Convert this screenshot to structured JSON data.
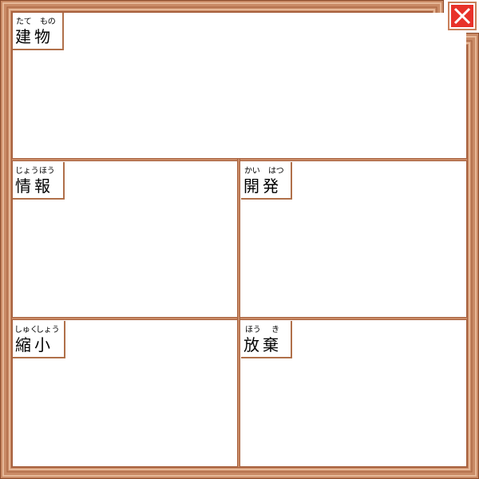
{
  "colors": {
    "frame_outer": "#c07a55",
    "frame_light": "#e3b79a",
    "frame_dark": "#8b4a2b",
    "close_red": "#e8322a"
  },
  "sections": [
    {
      "id": "building",
      "kanji": "建物",
      "ruby": [
        "たて",
        "もの"
      ]
    },
    {
      "id": "info",
      "kanji": "情報",
      "ruby": [
        "じょう",
        "ほう"
      ]
    },
    {
      "id": "dev",
      "kanji": "開発",
      "ruby": [
        "かい",
        "はつ"
      ]
    },
    {
      "id": "shrink",
      "kanji": "縮小",
      "ruby": [
        "しゅく",
        "しょう"
      ]
    },
    {
      "id": "discard",
      "kanji": "放棄",
      "ruby": [
        "ほう",
        "き"
      ]
    }
  ],
  "close_button": {
    "icon": "close-icon"
  }
}
